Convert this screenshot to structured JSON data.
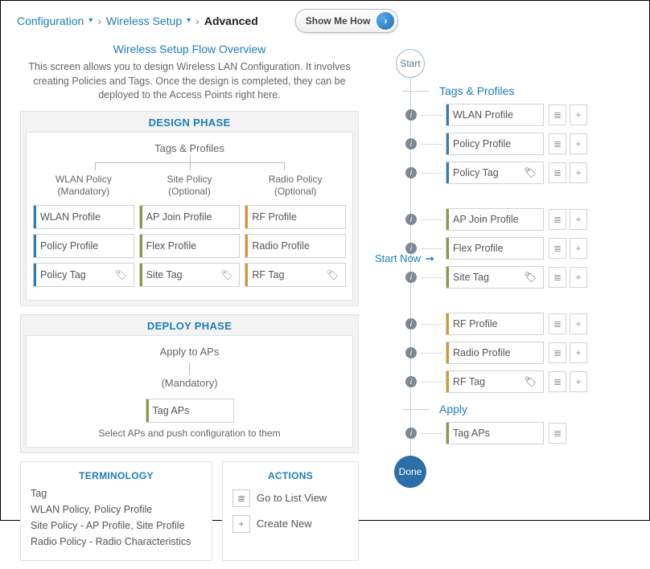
{
  "breadcrumb": {
    "item1": "Configuration",
    "item2": "Wireless Setup",
    "current": "Advanced",
    "show_me": "Show Me How"
  },
  "overview": {
    "title": "Wireless Setup Flow Overview",
    "intro": "This screen allows you to design Wireless LAN Configuration. It involves creating Policies and Tags. Once the design is completed, they can be deployed to the Access Points right here."
  },
  "design": {
    "title": "DESIGN PHASE",
    "subhead": "Tags & Profiles",
    "cols": {
      "wlan": {
        "label": "WLAN Policy\n(Mandatory)",
        "items": [
          "WLAN Profile",
          "Policy Profile",
          "Policy Tag"
        ]
      },
      "site": {
        "label": "Site Policy\n(Optional)",
        "items": [
          "AP Join Profile",
          "Flex Profile",
          "Site Tag"
        ]
      },
      "radio": {
        "label": "Radio Policy\n(Optional)",
        "items": [
          "RF Profile",
          "Radio Profile",
          "RF Tag"
        ]
      }
    }
  },
  "deploy": {
    "title": "DEPLOY PHASE",
    "subhead": "Apply to APs",
    "mandatory": "(Mandatory)",
    "button": "Tag APs",
    "note": "Select APs and push configuration to them"
  },
  "terminology": {
    "title": "TERMINOLOGY",
    "items": [
      "Tag",
      "WLAN Policy, Policy Profile",
      "Site Policy - AP Profile, Site Profile",
      "Radio Policy - Radio Characteristics"
    ]
  },
  "actions": {
    "title": "ACTIONS",
    "listview": "Go to List View",
    "create": "Create New"
  },
  "start_now": "Start Now",
  "timeline": {
    "start": "Start",
    "done": "Done",
    "tags_profiles": "Tags & Profiles",
    "apply": "Apply",
    "group1": [
      "WLAN Profile",
      "Policy Profile",
      "Policy Tag"
    ],
    "group2": [
      "AP Join Profile",
      "Flex Profile",
      "Site Tag"
    ],
    "group3": [
      "RF Profile",
      "Radio Profile",
      "RF Tag"
    ],
    "group4": [
      "Tag APs"
    ]
  }
}
